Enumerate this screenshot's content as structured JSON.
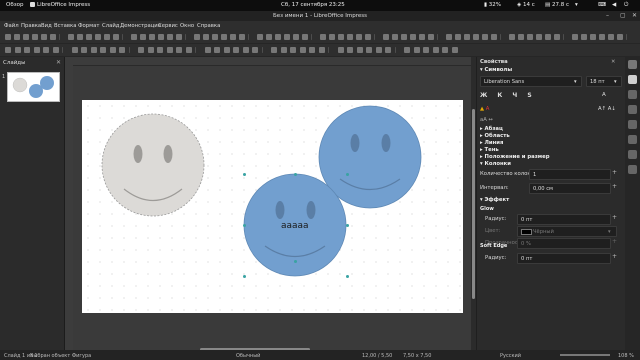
{
  "topbar": {
    "overview": "Обзор",
    "app": "LibreOffice Impress",
    "clock": "Сб, 17 сентября 23:25",
    "battery": "32%",
    "temp": "14 с",
    "disk": "27.8 с"
  },
  "window": {
    "title": "Без имени 1 - LibreOffice Impress"
  },
  "menu": [
    "Файл",
    "Правка",
    "Вид",
    "Вставка",
    "Формат",
    "Слайд",
    "Демонстрация",
    "Сервис",
    "Окно",
    "Справка"
  ],
  "slides_panel": {
    "title": "Слайды",
    "slide_number": "1"
  },
  "slide": {
    "text": "ааааа"
  },
  "colors": {
    "face_gray": "#dcdad7",
    "face_blue": "#729fcf",
    "face_eye": "#8a8a8a",
    "accent": "#3aa3a3"
  },
  "sidebar": {
    "title": "Свойства",
    "sections": {
      "character": "Символы",
      "paragraph": "Абзац",
      "area": "Область",
      "line": "Линия",
      "shadow": "Тень",
      "position": "Положение и размер",
      "columns": "Колонки",
      "effect": "Эффект"
    },
    "font_name": "Liberation Sans",
    "font_size": "18 пт",
    "columns_count_label": "Количество колонок:",
    "columns_count_value": "1",
    "spacing_label": "Интервал:",
    "spacing_value": "0,00 см",
    "glow_title": "Glow",
    "glow_radius_label": "Радиус:",
    "glow_radius_value": "0 пт",
    "glow_color_label": "Цвет:",
    "glow_color_value": "Чёрный",
    "glow_transparency_label": "Прозрачность:",
    "glow_transparency_value": "0 %",
    "soft_edge_title": "Soft Edge",
    "soft_edge_radius_label": "Радиус:",
    "soft_edge_radius_value": "0 пт"
  },
  "status": {
    "slide_of": "Слайд 1 из 1",
    "selection": "Выбран объект Фигура",
    "layout": "Обычный",
    "position": "12,00 / 5,50",
    "size": "7,50 x 7,50",
    "language": "Русский",
    "zoom": "108 %"
  }
}
